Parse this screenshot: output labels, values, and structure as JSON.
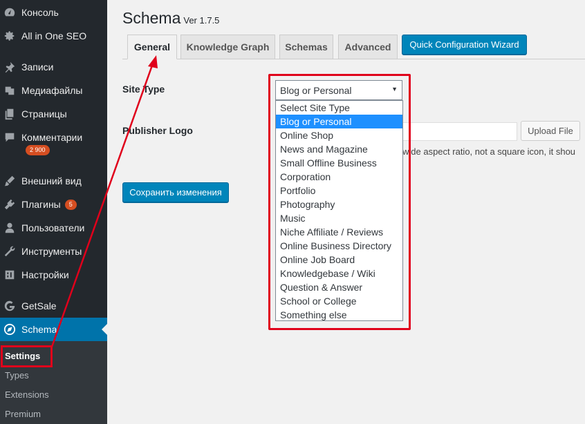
{
  "sidebar": {
    "items": [
      {
        "label": "Консоль",
        "icon": "dashboard-icon"
      },
      {
        "label": "All in One SEO",
        "icon": "gear-icon"
      },
      {
        "label": "Записи",
        "icon": "pin-icon"
      },
      {
        "label": "Медиафайлы",
        "icon": "media-icon"
      },
      {
        "label": "Страницы",
        "icon": "pages-icon"
      },
      {
        "label": "Комментарии",
        "icon": "comment-icon",
        "badge": "2 900"
      },
      {
        "label": "Внешний вид",
        "icon": "brush-icon"
      },
      {
        "label": "Плагины",
        "icon": "plugin-icon",
        "badge": "5"
      },
      {
        "label": "Пользователи",
        "icon": "user-icon"
      },
      {
        "label": "Инструменты",
        "icon": "wrench-icon"
      },
      {
        "label": "Настройки",
        "icon": "settings-icon"
      },
      {
        "label": "GetSale",
        "icon": "getsale-icon"
      },
      {
        "label": "Schema",
        "icon": "compass-icon"
      }
    ],
    "submenu": [
      "Settings",
      "Types",
      "Extensions",
      "Premium"
    ]
  },
  "page": {
    "title": "Schema",
    "version": "Ver 1.7.5"
  },
  "tabs": [
    "General",
    "Knowledge Graph",
    "Schemas",
    "Advanced"
  ],
  "wizard_button": "Quick Configuration Wizard",
  "fields": {
    "site_type_label": "Site Type",
    "publisher_logo_label": "Publisher Logo",
    "site_type_value": "Blog or Personal",
    "upload_button": "Upload File",
    "hint": "wide aspect ratio, not a square icon, it shou"
  },
  "dropdown": {
    "options": [
      "Select Site Type",
      "Blog or Personal",
      "Online Shop",
      "News and Magazine",
      "Small Offline Business",
      "Corporation",
      "Portfolio",
      "Photography",
      "Music",
      "Niche Affiliate / Reviews",
      "Online Business Directory",
      "Online Job Board",
      "Knowledgebase / Wiki",
      "Question & Answer",
      "School or College",
      "Something else"
    ],
    "selected": "Blog or Personal"
  },
  "save_button": "Сохранить изменения",
  "colors": {
    "sidebar_bg": "#23282d",
    "accent": "#0073aa",
    "highlight_red": "#e0001b",
    "badge": "#d54e21"
  }
}
